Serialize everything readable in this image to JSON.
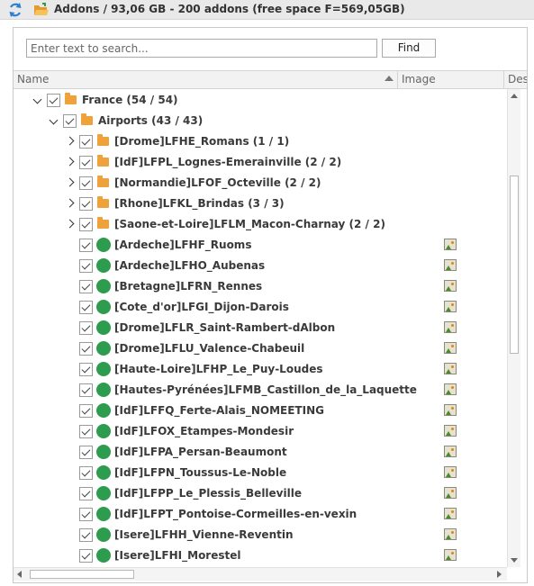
{
  "titlebar": {
    "title": "Addons / 93,06 GB - 200 addons (free space F=569,05GB)"
  },
  "search": {
    "placeholder": "Enter text to search...",
    "value": "",
    "find_label": "Find"
  },
  "columns": {
    "name": "Name",
    "image": "Image",
    "desc": "Des"
  },
  "tree": [
    {
      "label": "France (54 / 54)",
      "type": "folder",
      "indent": 0,
      "expander": "down",
      "image": false
    },
    {
      "label": "Airports (43 / 43)",
      "type": "folder",
      "indent": 1,
      "expander": "down",
      "image": false
    },
    {
      "label": "[Drome]LFHE_Romans (1 / 1)",
      "type": "folder",
      "indent": 2,
      "expander": "right",
      "image": false
    },
    {
      "label": "[IdF]LFPL_Lognes-Emerainville (2 / 2)",
      "type": "folder",
      "indent": 2,
      "expander": "right",
      "image": false
    },
    {
      "label": "[Normandie]LFOF_Octeville (2 / 2)",
      "type": "folder",
      "indent": 2,
      "expander": "right",
      "image": false
    },
    {
      "label": "[Rhone]LFKL_Brindas (3 / 3)",
      "type": "folder",
      "indent": 2,
      "expander": "right",
      "image": false
    },
    {
      "label": "[Saone-et-Loire]LFLM_Macon-Charnay (2 / 2)",
      "type": "folder",
      "indent": 2,
      "expander": "right",
      "image": false
    },
    {
      "label": "[Ardeche]LFHF_Ruoms",
      "type": "addon",
      "indent": 2,
      "expander": "none",
      "image": true
    },
    {
      "label": "[Ardeche]LFHO_Aubenas",
      "type": "addon",
      "indent": 2,
      "expander": "none",
      "image": true
    },
    {
      "label": "[Bretagne]LFRN_Rennes",
      "type": "addon",
      "indent": 2,
      "expander": "none",
      "image": true
    },
    {
      "label": "[Cote_d'or]LFGI_Dijon-Darois",
      "type": "addon",
      "indent": 2,
      "expander": "none",
      "image": true
    },
    {
      "label": "[Drome]LFLR_Saint-Rambert-dAlbon",
      "type": "addon",
      "indent": 2,
      "expander": "none",
      "image": true
    },
    {
      "label": "[Drome]LFLU_Valence-Chabeuil",
      "type": "addon",
      "indent": 2,
      "expander": "none",
      "image": true
    },
    {
      "label": "[Haute-Loire]LFHP_Le_Puy-Loudes",
      "type": "addon",
      "indent": 2,
      "expander": "none",
      "image": true
    },
    {
      "label": "[Hautes-Pyrénées]LFMB_Castillon_de_la_Laquette",
      "type": "addon",
      "indent": 2,
      "expander": "none",
      "image": true
    },
    {
      "label": "[IdF]LFFQ_Ferte-Alais_NOMEETING",
      "type": "addon",
      "indent": 2,
      "expander": "none",
      "image": true
    },
    {
      "label": "[IdF]LFOX_Etampes-Mondesir",
      "type": "addon",
      "indent": 2,
      "expander": "none",
      "image": true
    },
    {
      "label": "[IdF]LFPA_Persan-Beaumont",
      "type": "addon",
      "indent": 2,
      "expander": "none",
      "image": true
    },
    {
      "label": "[IdF]LFPN_Toussus-Le-Noble",
      "type": "addon",
      "indent": 2,
      "expander": "none",
      "image": true
    },
    {
      "label": "[IdF]LFPP_Le_Plessis_Belleville",
      "type": "addon",
      "indent": 2,
      "expander": "none",
      "image": true
    },
    {
      "label": "[IdF]LFPT_Pontoise-Cormeilles-en-vexin",
      "type": "addon",
      "indent": 2,
      "expander": "none",
      "image": true
    },
    {
      "label": "[Isere]LFHH_Vienne-Reventin",
      "type": "addon",
      "indent": 2,
      "expander": "none",
      "image": true
    },
    {
      "label": "[Isere]LFHI_Morestel",
      "type": "addon",
      "indent": 2,
      "expander": "none",
      "image": true
    }
  ],
  "colors": {
    "folder": "#f0a23a",
    "addon_dot": "#2e9c4f",
    "titlebar_bg": "#e9e9e9"
  },
  "icons": {
    "refresh": "refresh-icon",
    "folder": "folder-icon",
    "addon": "green-dot-icon",
    "image": "image-icon"
  }
}
